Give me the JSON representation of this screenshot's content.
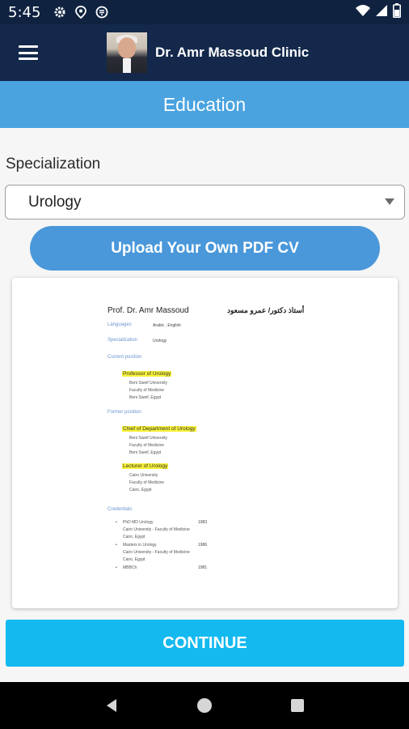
{
  "status_bar": {
    "time": "5:45",
    "left_icons": [
      "gear-icon",
      "location-icon",
      "cast-icon"
    ],
    "right_icons": [
      "wifi-icon",
      "signal-icon",
      "battery-icon"
    ]
  },
  "app_bar": {
    "title": "Dr. Amr Massoud Clinic",
    "menu_icon": "hamburger-menu-icon",
    "avatar_alt": "doctor photo"
  },
  "page_header": {
    "title": "Education"
  },
  "form": {
    "specialization_label": "Specialization",
    "specialization_value": "Urology"
  },
  "buttons": {
    "upload_label": "Upload Your Own PDF CV",
    "continue_label": "CONTINUE"
  },
  "pdf_preview": {
    "name_en": "Prof. Dr. Amr Massoud",
    "name_ar": "أستاذ دكتور/ عمرو مسعود",
    "languages_label": "Languages",
    "languages_value": "Arabic , English",
    "specialization_label": "Specialization",
    "specialization_value": "Urology",
    "current_position_label": "Current position",
    "current_title": "Professor of Urology",
    "current_lines": [
      "Beni Sweif University",
      "Faculty of Medicine",
      "Beni Sweif, Egypt"
    ],
    "former_position_label": "Former position",
    "former1_title": "Chief of Department of Urology",
    "former1_lines": [
      "Beni Sweif University",
      "Faculty of Medicine",
      "Beni Sweif, Egypt"
    ],
    "former2_title": "Lecturer of Urology",
    "former2_lines": [
      "Cairo University",
      "Faculty of Medicine",
      "Cairo, Egypt"
    ],
    "credentials_label": "Credentials",
    "credentials": [
      {
        "title": "PhD MD Urology",
        "year": "1983",
        "lines": [
          "Cairo University - Faculty of Medicine",
          "Cairo, Egypt"
        ]
      },
      {
        "title": "Masters in Urology",
        "year": "1986",
        "lines": [
          "Cairo University - Faculty of Medicine",
          "Cairo, Egypt"
        ]
      },
      {
        "title": "MBBCh",
        "year": "1981",
        "lines": []
      }
    ]
  },
  "nav_bar": {
    "icons": [
      "back-icon",
      "home-icon",
      "recents-icon"
    ]
  },
  "colors": {
    "status_bar": "#0f2341",
    "app_bar": "#13284b",
    "header": "#4aa3df",
    "upload_button": "#4a98da",
    "continue_button": "#13b9ef",
    "highlight": "#f8f23a"
  }
}
